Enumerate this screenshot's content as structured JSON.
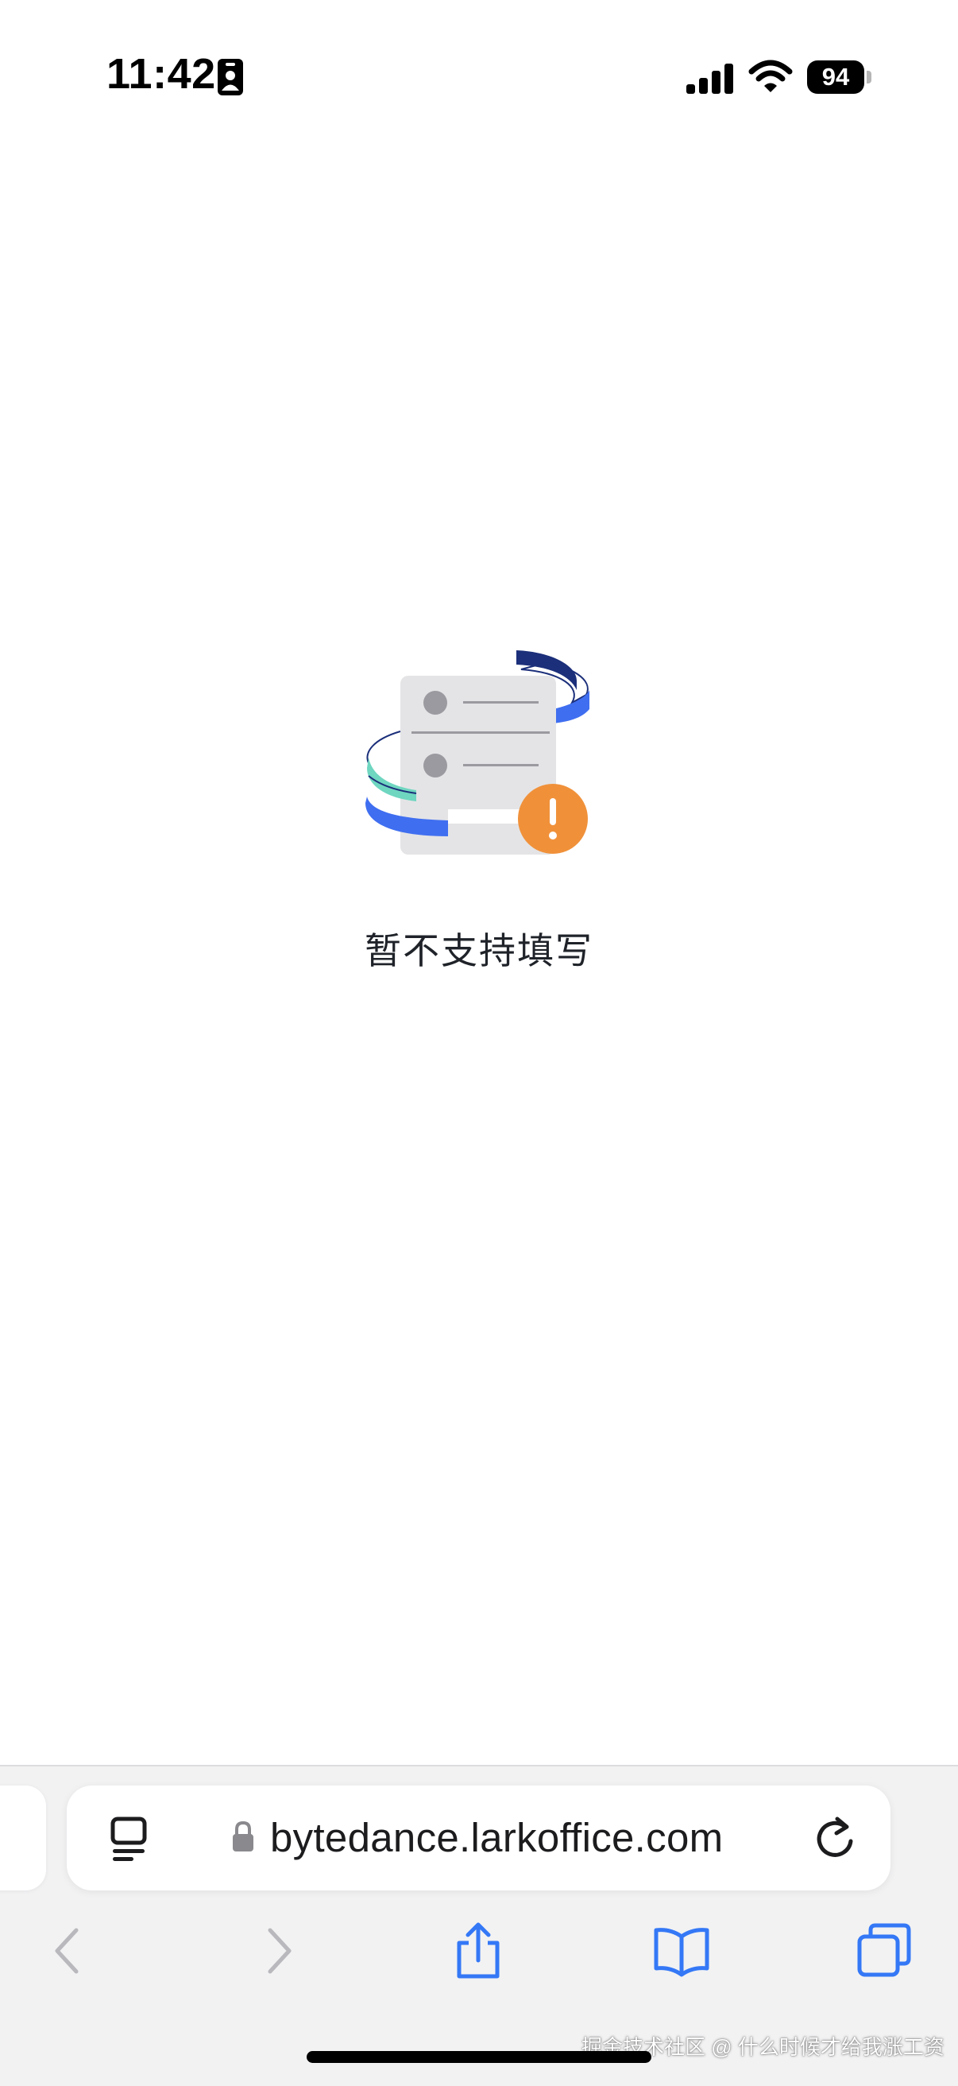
{
  "status_bar": {
    "time": "11:42",
    "battery_level": "94",
    "icons": [
      "id-card-icon",
      "cellular-signal-icon",
      "wifi-icon",
      "battery-icon"
    ]
  },
  "main": {
    "illustration": "form-unavailable-illustration",
    "message": "暂不支持填写"
  },
  "safari": {
    "url": "bytedance.larkoffice.com",
    "address_icons": [
      "page-menu-icon",
      "lock-icon",
      "reload-icon"
    ],
    "toolbar_icons": [
      "back-icon",
      "forward-icon",
      "share-icon",
      "bookmarks-icon",
      "tabs-icon"
    ]
  },
  "watermark": "掘金技术社区 @ 什么时候才给我涨工资",
  "colors": {
    "accent_blue": "#3478f6",
    "warning_orange": "#f0913a",
    "navy": "#1b2f7a",
    "mint": "#6fd6c0"
  }
}
